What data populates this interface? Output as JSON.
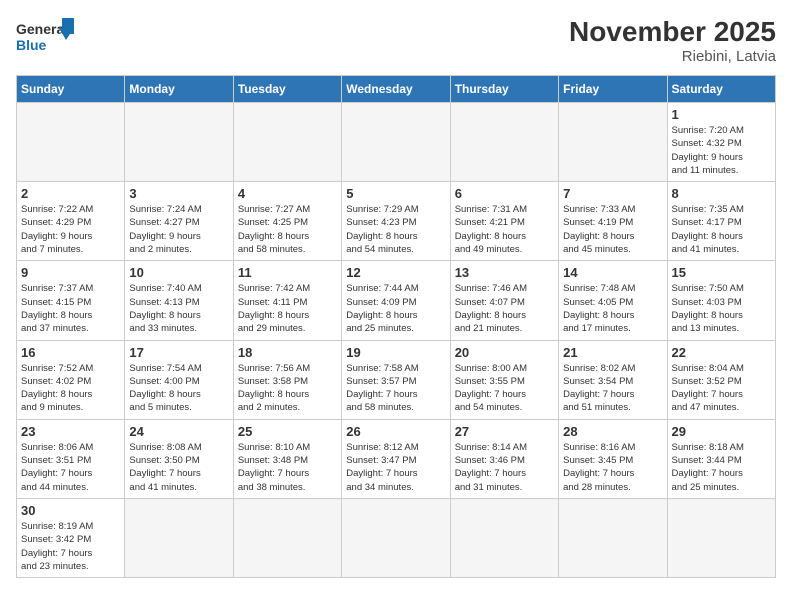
{
  "header": {
    "title": "November 2025",
    "subtitle": "Riebini, Latvia",
    "logo_general": "General",
    "logo_blue": "Blue"
  },
  "days_of_week": [
    "Sunday",
    "Monday",
    "Tuesday",
    "Wednesday",
    "Thursday",
    "Friday",
    "Saturday"
  ],
  "weeks": [
    [
      {
        "day": "",
        "info": "",
        "empty": true
      },
      {
        "day": "",
        "info": "",
        "empty": true
      },
      {
        "day": "",
        "info": "",
        "empty": true
      },
      {
        "day": "",
        "info": "",
        "empty": true
      },
      {
        "day": "",
        "info": "",
        "empty": true
      },
      {
        "day": "",
        "info": "",
        "empty": true
      },
      {
        "day": "1",
        "info": "Sunrise: 7:20 AM\nSunset: 4:32 PM\nDaylight: 9 hours\nand 11 minutes.",
        "empty": false
      }
    ],
    [
      {
        "day": "2",
        "info": "Sunrise: 7:22 AM\nSunset: 4:29 PM\nDaylight: 9 hours\nand 7 minutes.",
        "empty": false
      },
      {
        "day": "3",
        "info": "Sunrise: 7:24 AM\nSunset: 4:27 PM\nDaylight: 9 hours\nand 2 minutes.",
        "empty": false
      },
      {
        "day": "4",
        "info": "Sunrise: 7:27 AM\nSunset: 4:25 PM\nDaylight: 8 hours\nand 58 minutes.",
        "empty": false
      },
      {
        "day": "5",
        "info": "Sunrise: 7:29 AM\nSunset: 4:23 PM\nDaylight: 8 hours\nand 54 minutes.",
        "empty": false
      },
      {
        "day": "6",
        "info": "Sunrise: 7:31 AM\nSunset: 4:21 PM\nDaylight: 8 hours\nand 49 minutes.",
        "empty": false
      },
      {
        "day": "7",
        "info": "Sunrise: 7:33 AM\nSunset: 4:19 PM\nDaylight: 8 hours\nand 45 minutes.",
        "empty": false
      },
      {
        "day": "8",
        "info": "Sunrise: 7:35 AM\nSunset: 4:17 PM\nDaylight: 8 hours\nand 41 minutes.",
        "empty": false
      }
    ],
    [
      {
        "day": "9",
        "info": "Sunrise: 7:37 AM\nSunset: 4:15 PM\nDaylight: 8 hours\nand 37 minutes.",
        "empty": false
      },
      {
        "day": "10",
        "info": "Sunrise: 7:40 AM\nSunset: 4:13 PM\nDaylight: 8 hours\nand 33 minutes.",
        "empty": false
      },
      {
        "day": "11",
        "info": "Sunrise: 7:42 AM\nSunset: 4:11 PM\nDaylight: 8 hours\nand 29 minutes.",
        "empty": false
      },
      {
        "day": "12",
        "info": "Sunrise: 7:44 AM\nSunset: 4:09 PM\nDaylight: 8 hours\nand 25 minutes.",
        "empty": false
      },
      {
        "day": "13",
        "info": "Sunrise: 7:46 AM\nSunset: 4:07 PM\nDaylight: 8 hours\nand 21 minutes.",
        "empty": false
      },
      {
        "day": "14",
        "info": "Sunrise: 7:48 AM\nSunset: 4:05 PM\nDaylight: 8 hours\nand 17 minutes.",
        "empty": false
      },
      {
        "day": "15",
        "info": "Sunrise: 7:50 AM\nSunset: 4:03 PM\nDaylight: 8 hours\nand 13 minutes.",
        "empty": false
      }
    ],
    [
      {
        "day": "16",
        "info": "Sunrise: 7:52 AM\nSunset: 4:02 PM\nDaylight: 8 hours\nand 9 minutes.",
        "empty": false
      },
      {
        "day": "17",
        "info": "Sunrise: 7:54 AM\nSunset: 4:00 PM\nDaylight: 8 hours\nand 5 minutes.",
        "empty": false
      },
      {
        "day": "18",
        "info": "Sunrise: 7:56 AM\nSunset: 3:58 PM\nDaylight: 8 hours\nand 2 minutes.",
        "empty": false
      },
      {
        "day": "19",
        "info": "Sunrise: 7:58 AM\nSunset: 3:57 PM\nDaylight: 7 hours\nand 58 minutes.",
        "empty": false
      },
      {
        "day": "20",
        "info": "Sunrise: 8:00 AM\nSunset: 3:55 PM\nDaylight: 7 hours\nand 54 minutes.",
        "empty": false
      },
      {
        "day": "21",
        "info": "Sunrise: 8:02 AM\nSunset: 3:54 PM\nDaylight: 7 hours\nand 51 minutes.",
        "empty": false
      },
      {
        "day": "22",
        "info": "Sunrise: 8:04 AM\nSunset: 3:52 PM\nDaylight: 7 hours\nand 47 minutes.",
        "empty": false
      }
    ],
    [
      {
        "day": "23",
        "info": "Sunrise: 8:06 AM\nSunset: 3:51 PM\nDaylight: 7 hours\nand 44 minutes.",
        "empty": false
      },
      {
        "day": "24",
        "info": "Sunrise: 8:08 AM\nSunset: 3:50 PM\nDaylight: 7 hours\nand 41 minutes.",
        "empty": false
      },
      {
        "day": "25",
        "info": "Sunrise: 8:10 AM\nSunset: 3:48 PM\nDaylight: 7 hours\nand 38 minutes.",
        "empty": false
      },
      {
        "day": "26",
        "info": "Sunrise: 8:12 AM\nSunset: 3:47 PM\nDaylight: 7 hours\nand 34 minutes.",
        "empty": false
      },
      {
        "day": "27",
        "info": "Sunrise: 8:14 AM\nSunset: 3:46 PM\nDaylight: 7 hours\nand 31 minutes.",
        "empty": false
      },
      {
        "day": "28",
        "info": "Sunrise: 8:16 AM\nSunset: 3:45 PM\nDaylight: 7 hours\nand 28 minutes.",
        "empty": false
      },
      {
        "day": "29",
        "info": "Sunrise: 8:18 AM\nSunset: 3:44 PM\nDaylight: 7 hours\nand 25 minutes.",
        "empty": false
      }
    ],
    [
      {
        "day": "30",
        "info": "Sunrise: 8:19 AM\nSunset: 3:42 PM\nDaylight: 7 hours\nand 23 minutes.",
        "empty": false
      },
      {
        "day": "",
        "info": "",
        "empty": true
      },
      {
        "day": "",
        "info": "",
        "empty": true
      },
      {
        "day": "",
        "info": "",
        "empty": true
      },
      {
        "day": "",
        "info": "",
        "empty": true
      },
      {
        "day": "",
        "info": "",
        "empty": true
      },
      {
        "day": "",
        "info": "",
        "empty": true
      }
    ]
  ]
}
